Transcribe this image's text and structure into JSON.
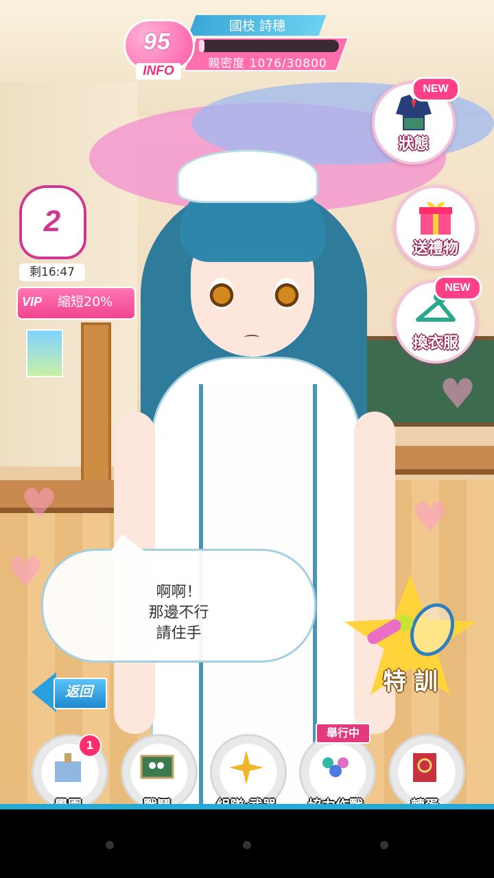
{
  "character": {
    "level": "95",
    "info_label": "INFO",
    "name": "國枝 詩穗",
    "affection_label": "親密度 1076/30800",
    "affection_progress": 0.035
  },
  "side_menu": {
    "status_label": "狀態",
    "gift_label": "送禮物",
    "outfit_label": "換衣服",
    "new_badge": "NEW"
  },
  "touch": {
    "count": "2",
    "timer": "剩16:47",
    "vip_tag": "VIP",
    "vip_text": "縮短20%"
  },
  "dialogue": {
    "lines": [
      "啊啊！",
      "那邊不行",
      "請住手"
    ]
  },
  "back_label": "返回",
  "training_label": "特 訓",
  "nav": {
    "items": [
      {
        "label": "學園",
        "badge": "1"
      },
      {
        "label": "戰鬥"
      },
      {
        "label": "組隊‧武器"
      },
      {
        "label": "協力作戰",
        "tag": "舉行中"
      },
      {
        "label": "轉蛋"
      }
    ]
  },
  "colors": {
    "accent_pink": "#ff5aa8",
    "accent_blue": "#2b9fe0",
    "hair": "#2f7b9c"
  }
}
